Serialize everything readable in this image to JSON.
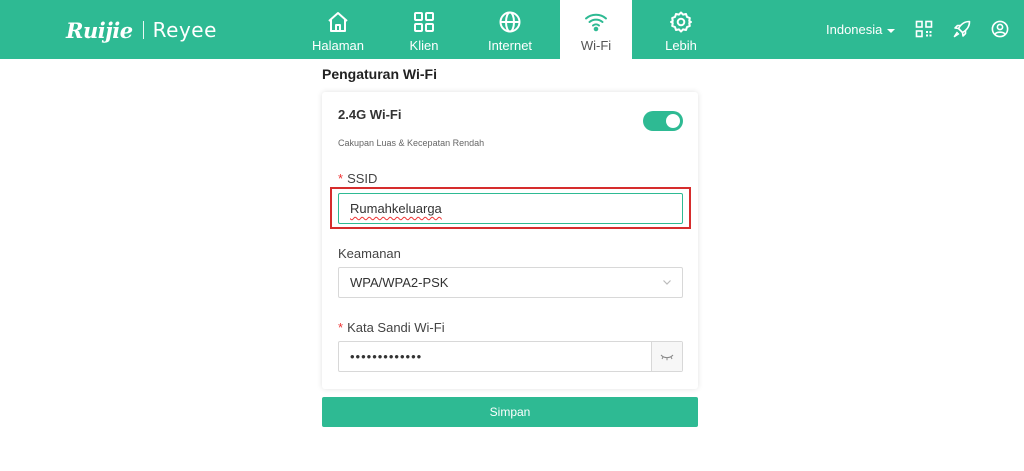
{
  "brand": {
    "logo_ruijie": "Ruijie",
    "logo_reyee": "Reyee"
  },
  "nav": {
    "items": [
      {
        "label": "Halaman",
        "icon": "home-icon"
      },
      {
        "label": "Klien",
        "icon": "grid-icon"
      },
      {
        "label": "Internet",
        "icon": "globe-icon"
      },
      {
        "label": "Wi-Fi",
        "icon": "wifi-icon",
        "active": true
      },
      {
        "label": "Lebih",
        "icon": "gear-icon"
      }
    ]
  },
  "header": {
    "language": "Indonesia",
    "icons": [
      "qr-code-icon",
      "rocket-icon",
      "user-account-icon"
    ]
  },
  "page": {
    "title": "Pengaturan Wi-Fi"
  },
  "wifi": {
    "band_title": "2.4G Wi-Fi",
    "band_subtitle": "Cakupan Luas & Kecepatan Rendah",
    "enabled": true,
    "ssid_label": "SSID",
    "ssid_value": "Rumahkeluarga",
    "security_label": "Keamanan",
    "security_value": "WPA/WPA2-PSK",
    "password_label": "Kata Sandi Wi-Fi",
    "password_masked": "•••••••••••••",
    "required_mark": "*"
  },
  "actions": {
    "save_label": "Simpan"
  },
  "colors": {
    "accent": "#2eba93",
    "highlight": "#d62d2d",
    "required": "#ee3333"
  }
}
